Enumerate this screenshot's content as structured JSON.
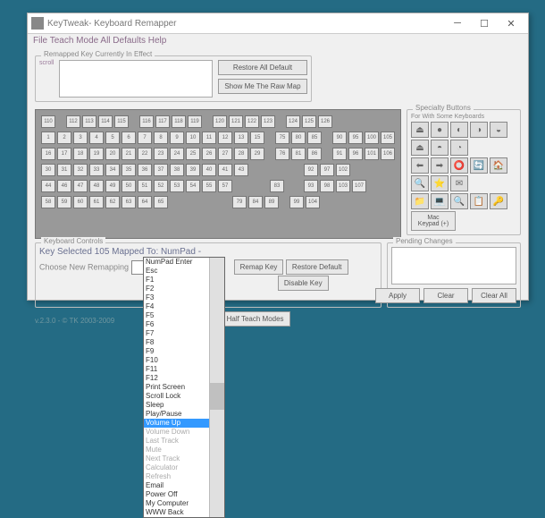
{
  "window": {
    "title": "KeyTweak- Keyboard Remapper"
  },
  "menu": "File Teach Mode All Defaults Help",
  "remapped": {
    "legend": "Remapped Key Currently In Effect",
    "scrolllabel": "scroll"
  },
  "btns": {
    "restoreAll": "Restore All Default",
    "showRaw": "Show Me The Raw Map",
    "remap": "Remap Key",
    "restoreDef": "Restore Default",
    "disable": "Disable Key",
    "halfTeach": "Half Teach Modes",
    "apply": "Apply",
    "clear": "Clear",
    "clearAll": "Clear All",
    "macKeypad": "Mac\nKeypad (+)"
  },
  "specialty": {
    "legend": "Specialty Buttons",
    "sub": "For With Some Keyboards"
  },
  "keys": {
    "r0": [
      "110",
      "",
      "112",
      "113",
      "114",
      "115",
      "",
      "116",
      "117",
      "118",
      "119",
      "",
      "120",
      "121",
      "122",
      "123",
      "",
      "124",
      "125",
      "126"
    ],
    "r1": [
      "1",
      "2",
      "3",
      "4",
      "5",
      "6",
      "7",
      "8",
      "9",
      "10",
      "11",
      "12",
      "13",
      "15",
      "",
      "75",
      "80",
      "85",
      "",
      "90",
      "95",
      "100",
      "105"
    ],
    "r2": [
      "16",
      "17",
      "18",
      "19",
      "20",
      "21",
      "22",
      "23",
      "24",
      "25",
      "26",
      "27",
      "28",
      "29",
      "",
      "76",
      "81",
      "86",
      "",
      "91",
      "96",
      "101",
      "106"
    ],
    "r3": [
      "30",
      "31",
      "32",
      "33",
      "34",
      "35",
      "36",
      "37",
      "38",
      "39",
      "40",
      "41",
      "43",
      "",
      "",
      "",
      "",
      "",
      "",
      "92",
      "97",
      "102"
    ],
    "r4": [
      "44",
      "46",
      "47",
      "48",
      "49",
      "50",
      "51",
      "52",
      "53",
      "54",
      "55",
      "57",
      "",
      "",
      "",
      "",
      "83",
      "",
      "",
      "93",
      "98",
      "103",
      "107"
    ],
    "r5": [
      "58",
      "59",
      "60",
      "61",
      "62",
      "63",
      "64",
      "65",
      "",
      "",
      "",
      "",
      "",
      "",
      "",
      "79",
      "84",
      "89",
      "",
      "99",
      "104"
    ]
  },
  "kc": {
    "legend": "Keyboard Controls",
    "sel": "Key Selected 105 Mapped To:  NumPad -",
    "choose": "Choose New Remapping"
  },
  "pending": {
    "legend": "Pending Changes"
  },
  "version": "v.2.3.0 - © TK 2003-2009",
  "dropdown": [
    "NumPad Enter",
    "Esc",
    "F1",
    "F2",
    "F3",
    "F4",
    "F5",
    "F6",
    "F7",
    "F8",
    "F9",
    "F10",
    "F11",
    "F12",
    "Print Screen",
    "Scroll Lock",
    "Sleep",
    "Play/Pause",
    "Volume Up",
    "Volume Down",
    "Last Track",
    "Mute",
    "Next Track",
    "Calculator",
    "Refresh",
    "Email",
    "Power Off",
    "My Computer",
    "WWW Back"
  ],
  "dd_highlight": 18,
  "dd_grey": [
    19,
    20,
    21,
    22,
    23,
    24
  ]
}
